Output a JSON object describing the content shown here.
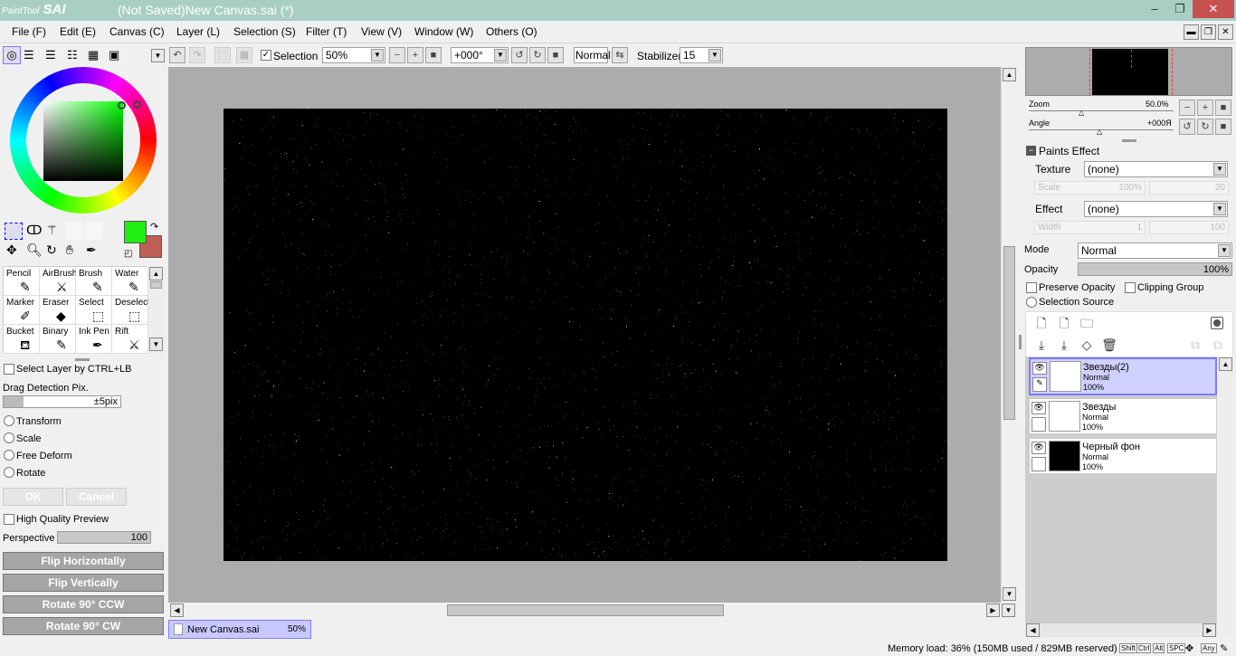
{
  "app": {
    "logo_small": "PaintTool",
    "logo_big": "SAI",
    "window_title": "(Not Saved)New Canvas.sai (*)"
  },
  "menu": [
    "File (F)",
    "Edit (E)",
    "Canvas (C)",
    "Layer (L)",
    "Selection (S)",
    "Filter (T)",
    "View (V)",
    "Window (W)",
    "Others (O)"
  ],
  "toolbar": {
    "selection_label": "Selection",
    "selection_checked": true,
    "zoom": "50%",
    "angle": "+000°",
    "mode": "Normal",
    "stabilizer_label": "Stabilizer",
    "stabilizer": "15"
  },
  "colors": {
    "primary": "#22ee11",
    "secondary": "#c06055",
    "accent_selection": "#7b7bff"
  },
  "tools": [
    {
      "label": "Pencil",
      "icon": "pencil-icon"
    },
    {
      "label": "AirBrush",
      "icon": "airbrush-icon"
    },
    {
      "label": "Brush",
      "icon": "brush-icon"
    },
    {
      "label": "Water",
      "icon": "water-icon"
    },
    {
      "label": "Marker",
      "icon": "marker-icon"
    },
    {
      "label": "Eraser",
      "icon": "eraser-icon"
    },
    {
      "label": "Select",
      "icon": "select-icon"
    },
    {
      "label": "Deselect",
      "icon": "deselect-icon"
    },
    {
      "label": "Bucket",
      "icon": "bucket-icon"
    },
    {
      "label": "Binary",
      "icon": "binary-icon"
    },
    {
      "label": "Ink Pen",
      "icon": "ink-pen-icon"
    },
    {
      "label": "Rift",
      "icon": "rift-icon"
    }
  ],
  "left": {
    "select_layer": "Select Layer by CTRL+LB",
    "drag_detection": "Drag Detection Pix.",
    "drag_value": "±5pix",
    "transform": "Transform",
    "scale": "Scale",
    "free_deform": "Free Deform",
    "rotate": "Rotate",
    "ok": "OK",
    "cancel": "Cancel",
    "hq_preview": "High Quality Preview",
    "perspective": "Perspective",
    "perspective_value": "100",
    "flip_h": "Flip Horizontally",
    "flip_v": "Flip Vertically",
    "rot_ccw": "Rotate 90° CCW",
    "rot_cw": "Rotate 90° CW"
  },
  "navigator": {
    "zoom_label": "Zoom",
    "zoom_value": "50.0%",
    "angle_label": "Angle",
    "angle_value": "+000Я"
  },
  "paints": {
    "title": "Paints Effect",
    "texture_label": "Texture",
    "texture_value": "(none)",
    "scale_label": "Scale",
    "scale_value": "100%",
    "scale_num": "20",
    "effect_label": "Effect",
    "effect_value": "(none)",
    "width_label": "Width",
    "width_value": "1",
    "width_num": "100"
  },
  "layer_props": {
    "mode_label": "Mode",
    "mode_value": "Normal",
    "opacity_label": "Opacity",
    "opacity_value": "100%",
    "preserve": "Preserve Opacity",
    "clipping": "Clipping Group",
    "selection_source": "Selection Source"
  },
  "layers": [
    {
      "name": "Звезды(2)",
      "mode": "Normal",
      "opacity": "100%",
      "thumb": "#ffffff",
      "selected": true
    },
    {
      "name": "Звезды",
      "mode": "Normal",
      "opacity": "100%",
      "thumb": "#ffffff",
      "selected": false
    },
    {
      "name": "Черный фон",
      "mode": "Normal",
      "opacity": "100%",
      "thumb": "#000000",
      "selected": false
    }
  ],
  "tab": {
    "name": "New Canvas.sai",
    "zoom": "50%"
  },
  "status": {
    "memory": "Memory load: 36% (150MB used / 829MB reserved)",
    "keys": [
      "Shift",
      "Ctrl",
      "Alt",
      "SPC",
      "Any"
    ]
  }
}
